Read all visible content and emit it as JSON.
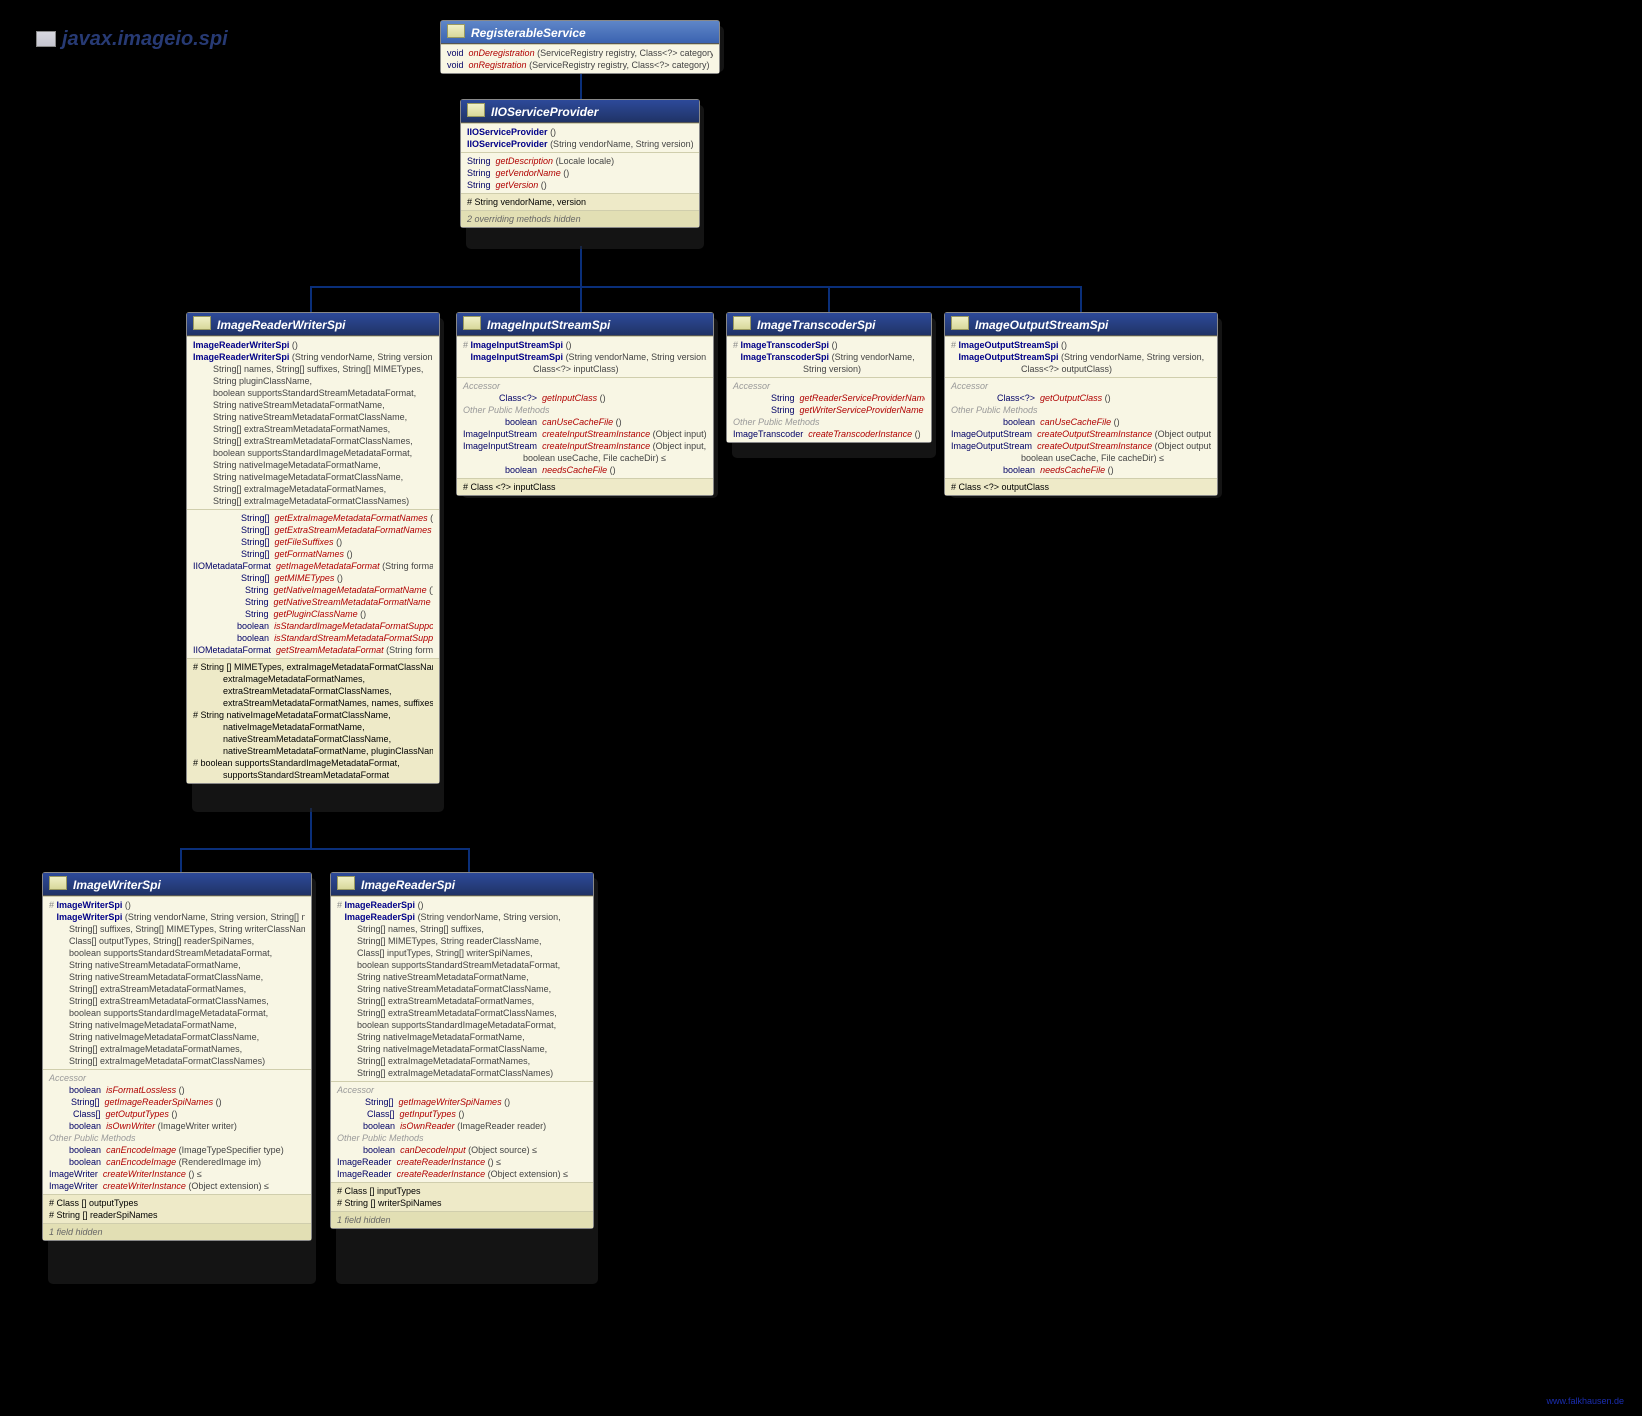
{
  "package": "javax.imageio.spi",
  "colors": {
    "header": "#2d4a9a",
    "body": "#f8f6e4",
    "fields": "#eeeac8",
    "note": "#e2dfb4",
    "line": "#0a2f7a"
  },
  "watermark": "www.falkhausen.de",
  "classes": {
    "RegisterableService": {
      "title": "RegisterableService",
      "methods": [
        {
          "ret": "void",
          "name": "onDeregistration",
          "params": "(ServiceRegistry registry, Class<?> category)"
        },
        {
          "ret": "void",
          "name": "onRegistration",
          "params": "(ServiceRegistry registry, Class<?> category)"
        }
      ]
    },
    "IIOServiceProvider": {
      "title": "IIOServiceProvider",
      "ctors": [
        {
          "name": "IIOServiceProvider",
          "params": "()"
        },
        {
          "name": "IIOServiceProvider",
          "params": "(String vendorName, String version)"
        }
      ],
      "methods": [
        {
          "ret": "String",
          "name": "getDescription",
          "params": "(Locale locale)"
        },
        {
          "ret": "String",
          "name": "getVendorName",
          "params": "()"
        },
        {
          "ret": "String",
          "name": "getVersion",
          "params": "()"
        }
      ],
      "fields": "# String  vendorName, version",
      "note": "2 overriding methods hidden"
    },
    "ImageReaderWriterSpi": {
      "title": "ImageReaderWriterSpi",
      "ctors": [
        {
          "name": "ImageReaderWriterSpi",
          "params": "()"
        },
        {
          "name": "ImageReaderWriterSpi",
          "paramsLines": [
            "(String vendorName, String version,",
            "String[] names, String[] suffixes, String[] MIMETypes,",
            "String pluginClassName,",
            "boolean supportsStandardStreamMetadataFormat,",
            "String nativeStreamMetadataFormatName,",
            "String nativeStreamMetadataFormatClassName,",
            "String[] extraStreamMetadataFormatNames,",
            "String[] extraStreamMetadataFormatClassNames,",
            "boolean supportsStandardImageMetadataFormat,",
            "String nativeImageMetadataFormatName,",
            "String nativeImageMetadataFormatClassName,",
            "String[] extraImageMetadataFormatNames,",
            "String[] extraImageMetadataFormatClassNames)"
          ]
        }
      ],
      "methods": [
        {
          "ret": "String[]",
          "name": "getExtraImageMetadataFormatNames",
          "params": "()"
        },
        {
          "ret": "String[]",
          "name": "getExtraStreamMetadataFormatNames",
          "params": "()"
        },
        {
          "ret": "String[]",
          "name": "getFileSuffixes",
          "params": "()"
        },
        {
          "ret": "String[]",
          "name": "getFormatNames",
          "params": "()"
        },
        {
          "ret": "IIOMetadataFormat",
          "name": "getImageMetadataFormat",
          "params": "(String formatName)"
        },
        {
          "ret": "String[]",
          "name": "getMIMETypes",
          "params": "()"
        },
        {
          "ret": "String",
          "name": "getNativeImageMetadataFormatName",
          "params": "()"
        },
        {
          "ret": "String",
          "name": "getNativeStreamMetadataFormatName",
          "params": "()"
        },
        {
          "ret": "String",
          "name": "getPluginClassName",
          "params": "()"
        },
        {
          "ret": "boolean",
          "name": "isStandardImageMetadataFormatSupported",
          "params": "()"
        },
        {
          "ret": "boolean",
          "name": "isStandardStreamMetadataFormatSupported",
          "params": "()"
        },
        {
          "ret": "IIOMetadataFormat",
          "name": "getStreamMetadataFormat",
          "params": "(String formatName)"
        }
      ],
      "fieldsLines": [
        "# String []  MIMETypes, extraImageMetadataFormatClassNames,",
        "                  extraImageMetadataFormatNames,",
        "                  extraStreamMetadataFormatClassNames,",
        "                  extraStreamMetadataFormatNames, names, suffixes",
        "# String  nativeImageMetadataFormatClassName,",
        "               nativeImageMetadataFormatName,",
        "               nativeStreamMetadataFormatClassName,",
        "               nativeStreamMetadataFormatName, pluginClassName",
        "# boolean  supportsStandardImageMetadataFormat,",
        "                 supportsStandardStreamMetadataFormat"
      ]
    },
    "ImageInputStreamSpi": {
      "title": "ImageInputStreamSpi",
      "ctors": [
        {
          "prot": true,
          "name": "ImageInputStreamSpi",
          "params": "()"
        },
        {
          "name": "ImageInputStreamSpi",
          "paramsLines": [
            "(String vendorName, String version,",
            "Class<?> inputClass)"
          ]
        }
      ],
      "sections": [
        {
          "label": "Accessor",
          "rows": [
            {
              "ret": "Class<?>",
              "name": "getInputClass",
              "params": "()"
            }
          ]
        },
        {
          "label": "Other Public Methods",
          "rows": [
            {
              "ret": "boolean",
              "name": "canUseCacheFile",
              "params": "()"
            },
            {
              "ret": "ImageInputStream",
              "name": "createInputStreamInstance",
              "params": "(Object input) ≤"
            },
            {
              "ret": "ImageInputStream",
              "name": "createInputStreamInstance",
              "params": "(Object input,"
            },
            {
              "ret": "",
              "name": "",
              "params": "                boolean useCache, File cacheDir) ≤"
            },
            {
              "ret": "boolean",
              "name": "needsCacheFile",
              "params": "()"
            }
          ]
        }
      ],
      "fields": "# Class <?>  inputClass"
    },
    "ImageTranscoderSpi": {
      "title": "ImageTranscoderSpi",
      "ctors": [
        {
          "prot": true,
          "name": "ImageTranscoderSpi",
          "params": "()"
        },
        {
          "name": "ImageTranscoderSpi",
          "paramsLines": [
            "(String vendorName,",
            "String version)"
          ]
        }
      ],
      "sections": [
        {
          "label": "Accessor",
          "rows": [
            {
              "ret": "String",
              "name": "getReaderServiceProviderName",
              "params": "()"
            },
            {
              "ret": "String",
              "name": "getWriterServiceProviderName",
              "params": "()"
            }
          ]
        },
        {
          "label": "Other Public Methods",
          "rows": [
            {
              "ret": "ImageTranscoder",
              "name": "createTranscoderInstance",
              "params": "()"
            }
          ]
        }
      ]
    },
    "ImageOutputStreamSpi": {
      "title": "ImageOutputStreamSpi",
      "ctors": [
        {
          "prot": true,
          "name": "ImageOutputStreamSpi",
          "params": "()"
        },
        {
          "name": "ImageOutputStreamSpi",
          "paramsLines": [
            "(String vendorName, String version,",
            "Class<?> outputClass)"
          ]
        }
      ],
      "sections": [
        {
          "label": "Accessor",
          "rows": [
            {
              "ret": "Class<?>",
              "name": "getOutputClass",
              "params": "()"
            }
          ]
        },
        {
          "label": "Other Public Methods",
          "rows": [
            {
              "ret": "boolean",
              "name": "canUseCacheFile",
              "params": "()"
            },
            {
              "ret": "ImageOutputStream",
              "name": "createOutputStreamInstance",
              "params": "(Object output) ≤"
            },
            {
              "ret": "ImageOutputStream",
              "name": "createOutputStreamInstance",
              "params": "(Object output,"
            },
            {
              "ret": "",
              "name": "",
              "params": "                boolean useCache, File cacheDir) ≤"
            },
            {
              "ret": "boolean",
              "name": "needsCacheFile",
              "params": "()"
            }
          ]
        }
      ],
      "fields": "# Class <?>  outputClass"
    },
    "ImageWriterSpi": {
      "title": "ImageWriterSpi",
      "ctors": [
        {
          "prot": true,
          "name": "ImageWriterSpi",
          "params": "()"
        },
        {
          "name": "ImageWriterSpi",
          "paramsLines": [
            "(String vendorName, String version, String[] names,",
            "String[] suffixes, String[] MIMETypes, String writerClassName,",
            "Class[] outputTypes, String[] readerSpiNames,",
            "boolean supportsStandardStreamMetadataFormat,",
            "String nativeStreamMetadataFormatName,",
            "String nativeStreamMetadataFormatClassName,",
            "String[] extraStreamMetadataFormatNames,",
            "String[] extraStreamMetadataFormatClassNames,",
            "boolean supportsStandardImageMetadataFormat,",
            "String nativeImageMetadataFormatName,",
            "String nativeImageMetadataFormatClassName,",
            "String[] extraImageMetadataFormatNames,",
            "String[] extraImageMetadataFormatClassNames)"
          ]
        }
      ],
      "sections": [
        {
          "label": "Accessor",
          "rows": [
            {
              "ret": "boolean",
              "name": "isFormatLossless",
              "params": "()"
            },
            {
              "ret": "String[]",
              "name": "getImageReaderSpiNames",
              "params": "()"
            },
            {
              "ret": "Class[]",
              "name": "getOutputTypes",
              "params": "()"
            },
            {
              "ret": "boolean",
              "name": "isOwnWriter",
              "params": "(ImageWriter writer)"
            }
          ]
        },
        {
          "label": "Other Public Methods",
          "rows": [
            {
              "ret": "boolean",
              "name": "canEncodeImage",
              "params": "(ImageTypeSpecifier type)"
            },
            {
              "ret": "boolean",
              "name": "canEncodeImage",
              "params": "(RenderedImage im)"
            },
            {
              "ret": "ImageWriter",
              "name": "createWriterInstance",
              "params": "() ≤"
            },
            {
              "ret": "ImageWriter",
              "name": "createWriterInstance",
              "params": "(Object extension) ≤"
            }
          ]
        }
      ],
      "fieldsLines": [
        "# Class []  outputTypes",
        "# String []  readerSpiNames"
      ],
      "note": "1 field hidden"
    },
    "ImageReaderSpi": {
      "title": "ImageReaderSpi",
      "ctors": [
        {
          "prot": true,
          "name": "ImageReaderSpi",
          "params": "()"
        },
        {
          "name": "ImageReaderSpi",
          "paramsLines": [
            "(String vendorName, String version,",
            "String[] names, String[] suffixes,",
            "String[] MIMETypes, String readerClassName,",
            "Class[] inputTypes, String[] writerSpiNames,",
            "boolean supportsStandardStreamMetadataFormat,",
            "String nativeStreamMetadataFormatName,",
            "String nativeStreamMetadataFormatClassName,",
            "String[] extraStreamMetadataFormatNames,",
            "String[] extraStreamMetadataFormatClassNames,",
            "boolean supportsStandardImageMetadataFormat,",
            "String nativeImageMetadataFormatName,",
            "String nativeImageMetadataFormatClassName,",
            "String[] extraImageMetadataFormatNames,",
            "String[] extraImageMetadataFormatClassNames)"
          ]
        }
      ],
      "sections": [
        {
          "label": "Accessor",
          "rows": [
            {
              "ret": "String[]",
              "name": "getImageWriterSpiNames",
              "params": "()"
            },
            {
              "ret": "Class[]",
              "name": "getInputTypes",
              "params": "()"
            },
            {
              "ret": "boolean",
              "name": "isOwnReader",
              "params": "(ImageReader reader)"
            }
          ]
        },
        {
          "label": "Other Public Methods",
          "rows": [
            {
              "ret": "boolean",
              "name": "canDecodeInput",
              "params": "(Object source) ≤"
            },
            {
              "ret": "ImageReader",
              "name": "createReaderInstance",
              "params": "() ≤"
            },
            {
              "ret": "ImageReader",
              "name": "createReaderInstance",
              "params": "(Object extension) ≤"
            }
          ]
        }
      ],
      "fieldsLines": [
        "# Class []  inputTypes",
        "# String []  writerSpiNames"
      ],
      "note": "1 field hidden"
    }
  }
}
